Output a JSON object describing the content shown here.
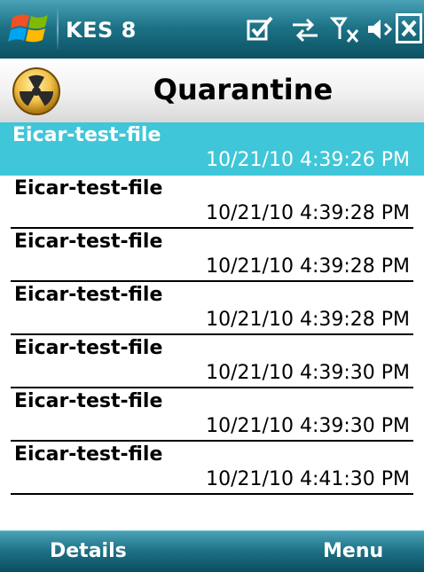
{
  "status": {
    "app_name": "KES 8",
    "icons": [
      "windows-start-icon",
      "task-checkbox-icon",
      "data-connection-icon",
      "signal-off-icon",
      "speaker-muted-icon",
      "close-icon"
    ]
  },
  "header": {
    "title": "Quarantine",
    "icon": "radiation-icon"
  },
  "quarantine": {
    "items": [
      {
        "name": "Eicar-test-file",
        "date": "10/21/10 4:39:26 PM",
        "selected": true
      },
      {
        "name": "Eicar-test-file",
        "date": "10/21/10 4:39:28 PM"
      },
      {
        "name": "Eicar-test-file",
        "date": "10/21/10 4:39:28 PM"
      },
      {
        "name": "Eicar-test-file",
        "date": "10/21/10 4:39:28 PM"
      },
      {
        "name": "Eicar-test-file",
        "date": "10/21/10 4:39:30 PM"
      },
      {
        "name": "Eicar-test-file",
        "date": "10/21/10 4:39:30 PM"
      },
      {
        "name": "Eicar-test-file",
        "date": "10/21/10 4:41:30 PM"
      }
    ]
  },
  "softkeys": {
    "left": "Details",
    "right": "Menu"
  },
  "colors": {
    "bar_dark": "#0b5163",
    "bar_light": "#4aa2b6",
    "selection": "#3fc6d8"
  }
}
